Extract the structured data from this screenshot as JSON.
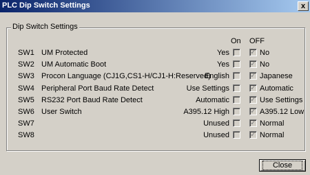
{
  "window": {
    "title": "PLC Dip Switch Settings",
    "close_glyph": "x"
  },
  "group": {
    "label": "Dip Switch Settings"
  },
  "columns": {
    "on": "On",
    "off": "OFF"
  },
  "rows": [
    {
      "sw": "SW1",
      "desc": "UM Protected",
      "on_value": "Yes",
      "off_value": "No",
      "on_checked": false,
      "off_checked": true
    },
    {
      "sw": "SW2",
      "desc": "UM Automatic Boot",
      "on_value": "Yes",
      "off_value": "No",
      "on_checked": false,
      "off_checked": true
    },
    {
      "sw": "SW3",
      "desc": "Procon Language (CJ1G,CS1-H/CJ1-H:Reserved)",
      "on_value": "English",
      "off_value": "Japanese",
      "on_checked": false,
      "off_checked": true
    },
    {
      "sw": "SW4",
      "desc": "Peripheral Port Baud Rate Detect",
      "on_value": "Use Settings",
      "off_value": "Automatic",
      "on_checked": false,
      "off_checked": true
    },
    {
      "sw": "SW5",
      "desc": "RS232 Port Baud Rate Detect",
      "on_value": "Automatic",
      "off_value": "Use Settings",
      "on_checked": false,
      "off_checked": true
    },
    {
      "sw": "SW6",
      "desc": "User Switch",
      "on_value": "A395.12 High",
      "off_value": "A395.12 Low",
      "on_checked": false,
      "off_checked": true
    },
    {
      "sw": "SW7",
      "desc": "",
      "on_value": "Unused",
      "off_value": "Normal",
      "on_checked": false,
      "off_checked": true
    },
    {
      "sw": "SW8",
      "desc": "",
      "on_value": "Unused",
      "off_value": "Normal",
      "on_checked": false,
      "off_checked": true
    }
  ],
  "buttons": {
    "close": "Close"
  }
}
